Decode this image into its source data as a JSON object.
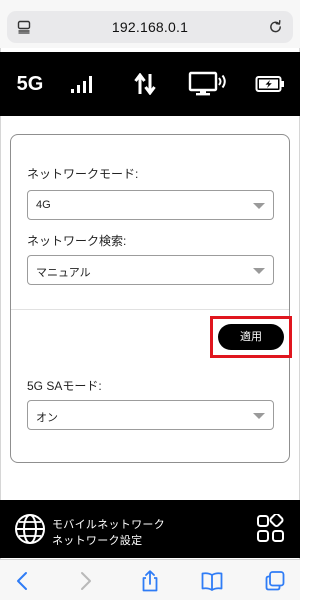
{
  "browser": {
    "url": "192.168.0.1",
    "reload_icon": "reload-icon",
    "page_menu_icon": "page-menu-icon"
  },
  "status_bar": {
    "network_type": "5G",
    "icons": [
      "signal-bars-icon",
      "data-transfer-arrows-icon",
      "connected-device-icon",
      "battery-charging-icon"
    ]
  },
  "form": {
    "network_mode": {
      "label": "ネットワークモード:",
      "value": "4G"
    },
    "network_search": {
      "label": "ネットワーク検索:",
      "value": "マニュアル"
    },
    "apply_label": "適用",
    "sa_mode": {
      "label": "5G SAモード:",
      "value": "オン"
    }
  },
  "banner": {
    "title": "モバイルネットワーク",
    "subtitle": "ネットワーク設定",
    "icons": [
      "globe-icon",
      "apps-grid-icon"
    ]
  },
  "toolbar": {
    "icons": [
      "back-icon",
      "forward-icon",
      "share-icon",
      "bookmarks-icon",
      "tabs-icon"
    ]
  },
  "colors": {
    "accent": "#000000",
    "highlight": "#e0161e",
    "link": "#2f7cf6"
  }
}
